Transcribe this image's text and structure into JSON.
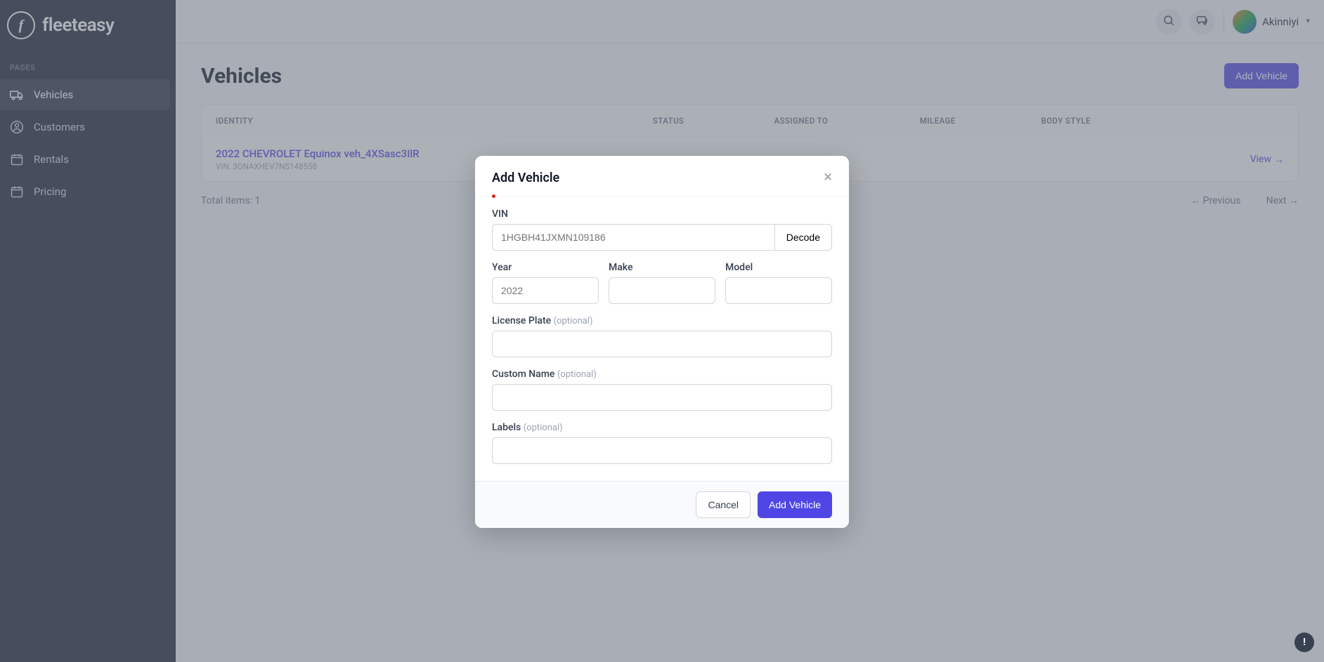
{
  "brand": {
    "name": "fleeteasy",
    "letter": "f"
  },
  "sidebar": {
    "section_label": "PAGES",
    "items": [
      {
        "label": "Vehicles"
      },
      {
        "label": "Customers"
      },
      {
        "label": "Rentals"
      },
      {
        "label": "Pricing"
      }
    ]
  },
  "header": {
    "user_name": "Akinniyi"
  },
  "page": {
    "title": "Vehicles",
    "add_button": "Add Vehicle"
  },
  "table": {
    "columns": [
      "IDENTITY",
      "STATUS",
      "ASSIGNED TO",
      "MILEAGE",
      "BODY STYLE",
      ""
    ],
    "rows": [
      {
        "identity_title": "2022 CHEVROLET Equinox veh_4XSasc3IlR",
        "identity_sub": "VIN: 3GNAXHEV7NS148558",
        "view_label": "View"
      }
    ]
  },
  "pager": {
    "total": "Total items: 1",
    "prev": "Previous",
    "next": "Next"
  },
  "modal": {
    "title": "Add Vehicle",
    "vin_label": "VIN",
    "vin_placeholder": "1HGBH41JXMN109186",
    "decode": "Decode",
    "year_label": "Year",
    "year_placeholder": "2022",
    "make_label": "Make",
    "model_label": "Model",
    "license_label": "License Plate",
    "custom_label": "Custom Name",
    "labels_label": "Labels",
    "optional": "(optional)",
    "cancel": "Cancel",
    "submit": "Add Vehicle"
  }
}
